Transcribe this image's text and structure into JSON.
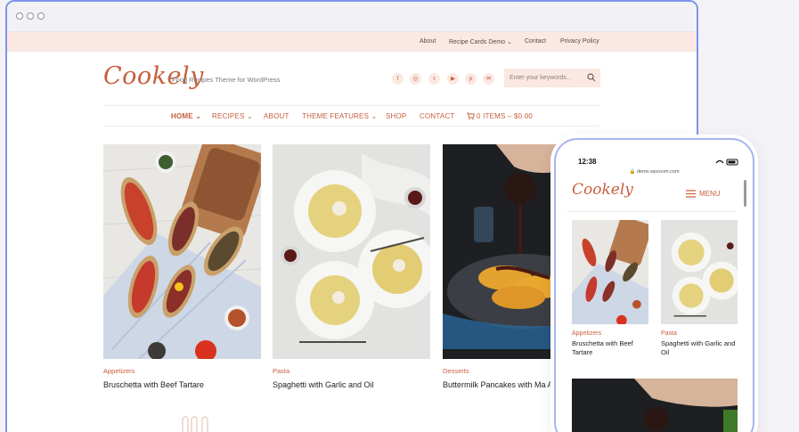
{
  "window": {
    "controls": [
      "close",
      "minimize",
      "maximize"
    ]
  },
  "topbar": {
    "links": [
      "About",
      "Recipe Cards Demo ⌄",
      "Contact",
      "Privacy Policy"
    ]
  },
  "header": {
    "logo": "Cookely",
    "tagline": "Food Recipes Theme for WordPress",
    "social": [
      "facebook-icon",
      "instagram-icon",
      "twitter-icon",
      "youtube-icon",
      "pinterest-icon",
      "email-icon"
    ],
    "search": {
      "placeholder": "Enter your keywords..."
    }
  },
  "nav": {
    "items": [
      "HOME ⌄",
      "RECIPES ⌄",
      "ABOUT",
      "THEME FEATURES ⌄",
      "SHOP",
      "CONTACT",
      "0 ITEMS – $0.00"
    ]
  },
  "cards": [
    {
      "category": "Appetizers",
      "title": "Bruschetta with Beef Tartare"
    },
    {
      "category": "Pasta",
      "title": "Spaghetti with Garlic and Oil"
    },
    {
      "category": "Desserts",
      "title": "Buttermilk Pancakes with Ma Apples"
    }
  ],
  "phone": {
    "time": "12:38",
    "url": "🔒 demo.wpzoom.com",
    "logo": "Cookely",
    "menu": "MENU",
    "cards": [
      {
        "category": "Appetizers",
        "title": "Bruschetta with Beef Tartare"
      },
      {
        "category": "Pasta",
        "title": "Spaghetti with Garlic and Oil"
      }
    ]
  },
  "colors": {
    "accent": "#c65f3c",
    "topbar_bg": "#fbe8e2",
    "frame": "#7f93ea"
  }
}
